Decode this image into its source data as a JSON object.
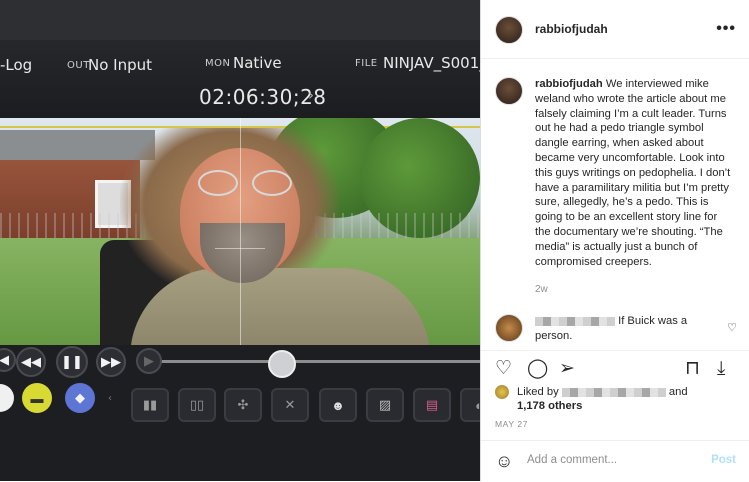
{
  "camera": {
    "log_label": "-Log",
    "out_label": "OUT",
    "out_value": "No Input",
    "mon_label": "MON",
    "mon_value": "Native",
    "file_label": "FILE",
    "file_value": "NINJAV_S001_",
    "timecode": "02:06:30;28",
    "timecode_arrow": "›"
  },
  "post": {
    "author": "rabbiofjudah",
    "more_icon": "more-horizontal-icon",
    "caption": "We interviewed mike weland who wrote the article about me falsely claiming I’m a cult leader. Turns out he had a pedo triangle symbol dangle earring, when asked about became very uncomfortable. Look into this guys writings on pedophelia. I don’t have a paramilitary militia but I’m pretty sure, allegedly, he’s a pedo. This is going to be an excellent story line for the documentary we’re shouting. “The media” is actually just a bunch of compromised creepers.",
    "age": "2w",
    "comment_text": "If Buick was a person.",
    "liked_by_prefix": "Liked by",
    "liked_by_and": "and",
    "others": "1,178 others",
    "date": "MAY 27",
    "add_comment_placeholder": "Add a comment...",
    "post_button": "Post"
  },
  "icons": {
    "like": "heart-icon",
    "comment": "comment-icon",
    "share": "paper-plane-icon",
    "save": "bookmark-icon",
    "download": "download-icon",
    "emoji": "emoji-icon"
  },
  "colors": {
    "post_button_disabled": "#b2dffc",
    "text_primary": "#262626",
    "text_secondary": "#8e8e8e"
  }
}
